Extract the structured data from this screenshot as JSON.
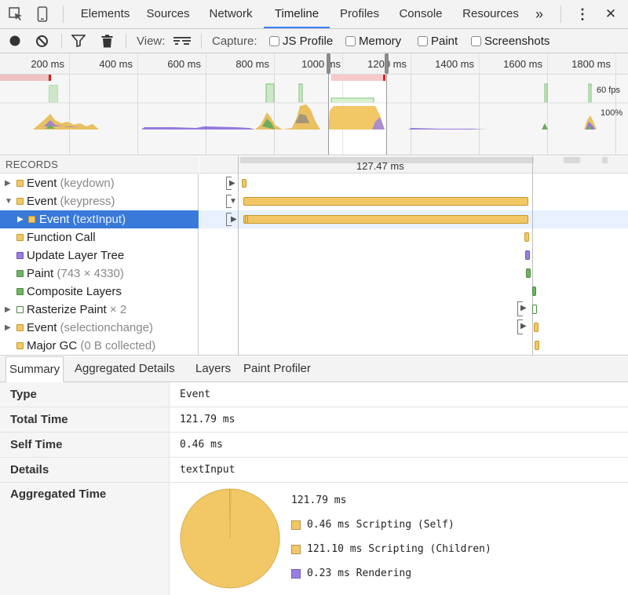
{
  "tabs": [
    "Elements",
    "Sources",
    "Network",
    "Timeline",
    "Profiles",
    "Console",
    "Resources"
  ],
  "tabs_overflow": "»",
  "tabs_menu": "⋮",
  "tabs_close": "✕",
  "toolbar": {
    "view_label": "View:",
    "capture_label": "Capture:",
    "checkboxes": [
      "JS Profile",
      "Memory",
      "Paint",
      "Screenshots"
    ]
  },
  "overview": {
    "ticks": [
      "200 ms",
      "400 ms",
      "600 ms",
      "800 ms",
      "1000 ms",
      "1200 ms",
      "1400 ms",
      "1600 ms",
      "1800 ms"
    ],
    "fps_label": "60 fps",
    "cpu_label": "100%"
  },
  "records": {
    "header": "RECORDS",
    "window_duration": "127.47 ms",
    "rows": [
      {
        "name": "Event",
        "detail": "(keydown)"
      },
      {
        "name": "Event",
        "detail": "(keypress)"
      },
      {
        "name": "Event",
        "detail": "(textInput)"
      },
      {
        "name": "Function Call",
        "detail": ""
      },
      {
        "name": "Update Layer Tree",
        "detail": ""
      },
      {
        "name": "Paint",
        "detail": "(743 × 4330)"
      },
      {
        "name": "Composite Layers",
        "detail": ""
      },
      {
        "name": "Rasterize Paint",
        "detail": "× 2"
      },
      {
        "name": "Event",
        "detail": "(selectionchange)"
      },
      {
        "name": "Major GC",
        "detail": "(0 B collected)"
      }
    ]
  },
  "detail_tabs": [
    "Summary",
    "Aggregated Details",
    "Layers",
    "Paint Profiler"
  ],
  "summary": {
    "type_key": "Type",
    "type_val": "Event",
    "total_key": "Total Time",
    "total_val": "121.79 ms",
    "self_key": "Self Time",
    "self_val": "0.46 ms",
    "details_key": "Details",
    "details_val": "textInput",
    "agg_key": "Aggregated Time",
    "agg_total": "121.79 ms",
    "legend": [
      {
        "label": "0.46 ms Scripting (Self)",
        "value": 0.46,
        "color": "#f2c766"
      },
      {
        "label": "121.10 ms Scripting (Children)",
        "value": 121.1,
        "color": "#f2c766"
      },
      {
        "label": "0.23 ms Rendering",
        "value": 0.23,
        "color": "#9a7ee6"
      }
    ]
  },
  "colors": {
    "scripting": "#f2c766",
    "rendering": "#9a7ee6",
    "painting": "#71b363",
    "selection": "#3879d9",
    "accent": "#3d7ef5"
  }
}
